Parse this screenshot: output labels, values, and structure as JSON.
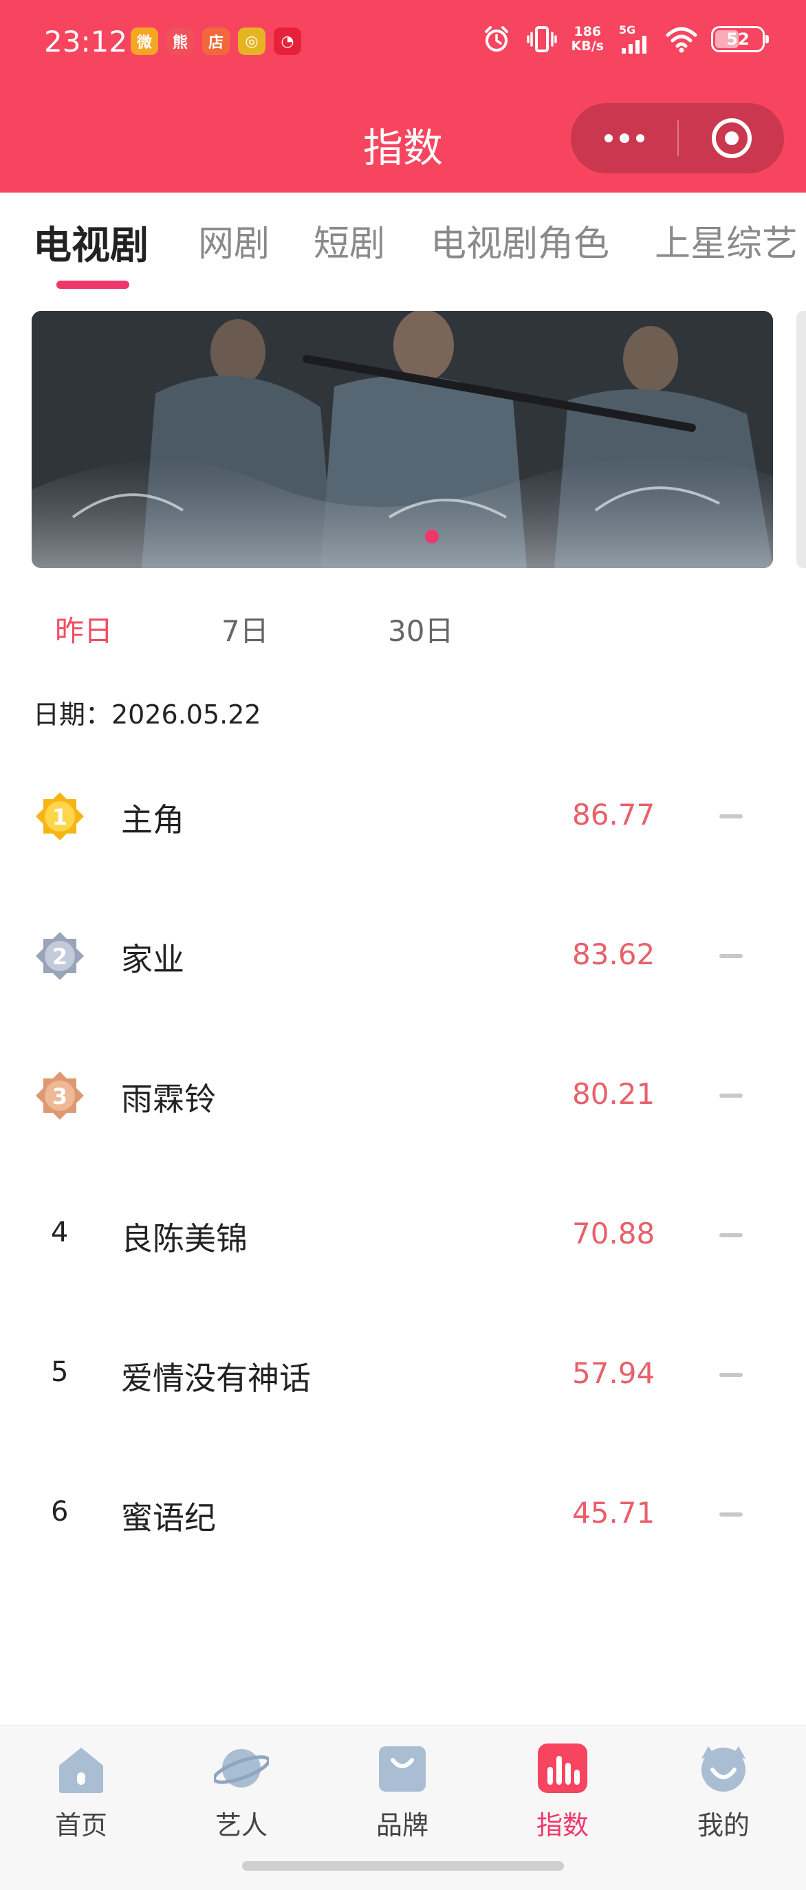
{
  "status_bar": {
    "time": "23:12",
    "apps": [
      {
        "icon": "weibo-icon",
        "color": "#f5a623",
        "glyph": "微"
      },
      {
        "icon": "panda-app-icon",
        "color": "#f0505a",
        "glyph": "熊"
      },
      {
        "icon": "shop-app-icon",
        "color": "#f2683c",
        "glyph": "店"
      },
      {
        "icon": "music-app-icon",
        "color": "#e6b422",
        "glyph": "◎"
      },
      {
        "icon": "netease-music-icon",
        "color": "#e8213b",
        "glyph": "◔"
      }
    ],
    "net_speed_value": "186",
    "net_speed_unit": "KB/s",
    "network": "5G",
    "battery": "52",
    "battery_level": 0.52
  },
  "header": {
    "title": "指数",
    "more_icon": "more-dots-icon",
    "close_icon": "target-icon"
  },
  "category_tabs": [
    {
      "label": "电视剧",
      "active": true
    },
    {
      "label": "网剧",
      "active": false
    },
    {
      "label": "短剧",
      "active": false
    },
    {
      "label": "电视剧角色",
      "active": false
    },
    {
      "label": "上星综艺",
      "active": false
    }
  ],
  "banner": {
    "current_slide": 1
  },
  "period_tabs": [
    {
      "label": "昨日",
      "active": true
    },
    {
      "label": "7日",
      "active": false
    },
    {
      "label": "30日",
      "active": false
    }
  ],
  "date_line": "日期：2026.05.22",
  "rankings": [
    {
      "rank": "1",
      "badge": "gold-medal-icon",
      "name": "主角",
      "score": "86.77"
    },
    {
      "rank": "2",
      "badge": "silver-medal-icon",
      "name": "家业",
      "score": "83.62"
    },
    {
      "rank": "3",
      "badge": "bronze-medal-icon",
      "name": "雨霖铃",
      "score": "80.21"
    },
    {
      "rank": "4",
      "badge": "",
      "name": "良陈美锦",
      "score": "70.88"
    },
    {
      "rank": "5",
      "badge": "",
      "name": "爱情没有神话",
      "score": "57.94"
    },
    {
      "rank": "6",
      "badge": "",
      "name": "蜜语纪",
      "score": "45.71"
    }
  ],
  "bottom_nav": [
    {
      "label": "首页",
      "icon": "home-icon",
      "active": false
    },
    {
      "label": "艺人",
      "icon": "planet-icon",
      "active": false
    },
    {
      "label": "品牌",
      "icon": "shopping-bag-icon",
      "active": false
    },
    {
      "label": "指数",
      "icon": "bar-chart-icon",
      "active": true
    },
    {
      "label": "我的",
      "icon": "profile-icon",
      "active": false
    }
  ],
  "colors": {
    "brand": "#f7455f",
    "accent": "#f0376b",
    "score": "#e8606a",
    "gold": "#f6b514",
    "silver": "#9aa4b8",
    "bronze": "#dd9a72"
  }
}
